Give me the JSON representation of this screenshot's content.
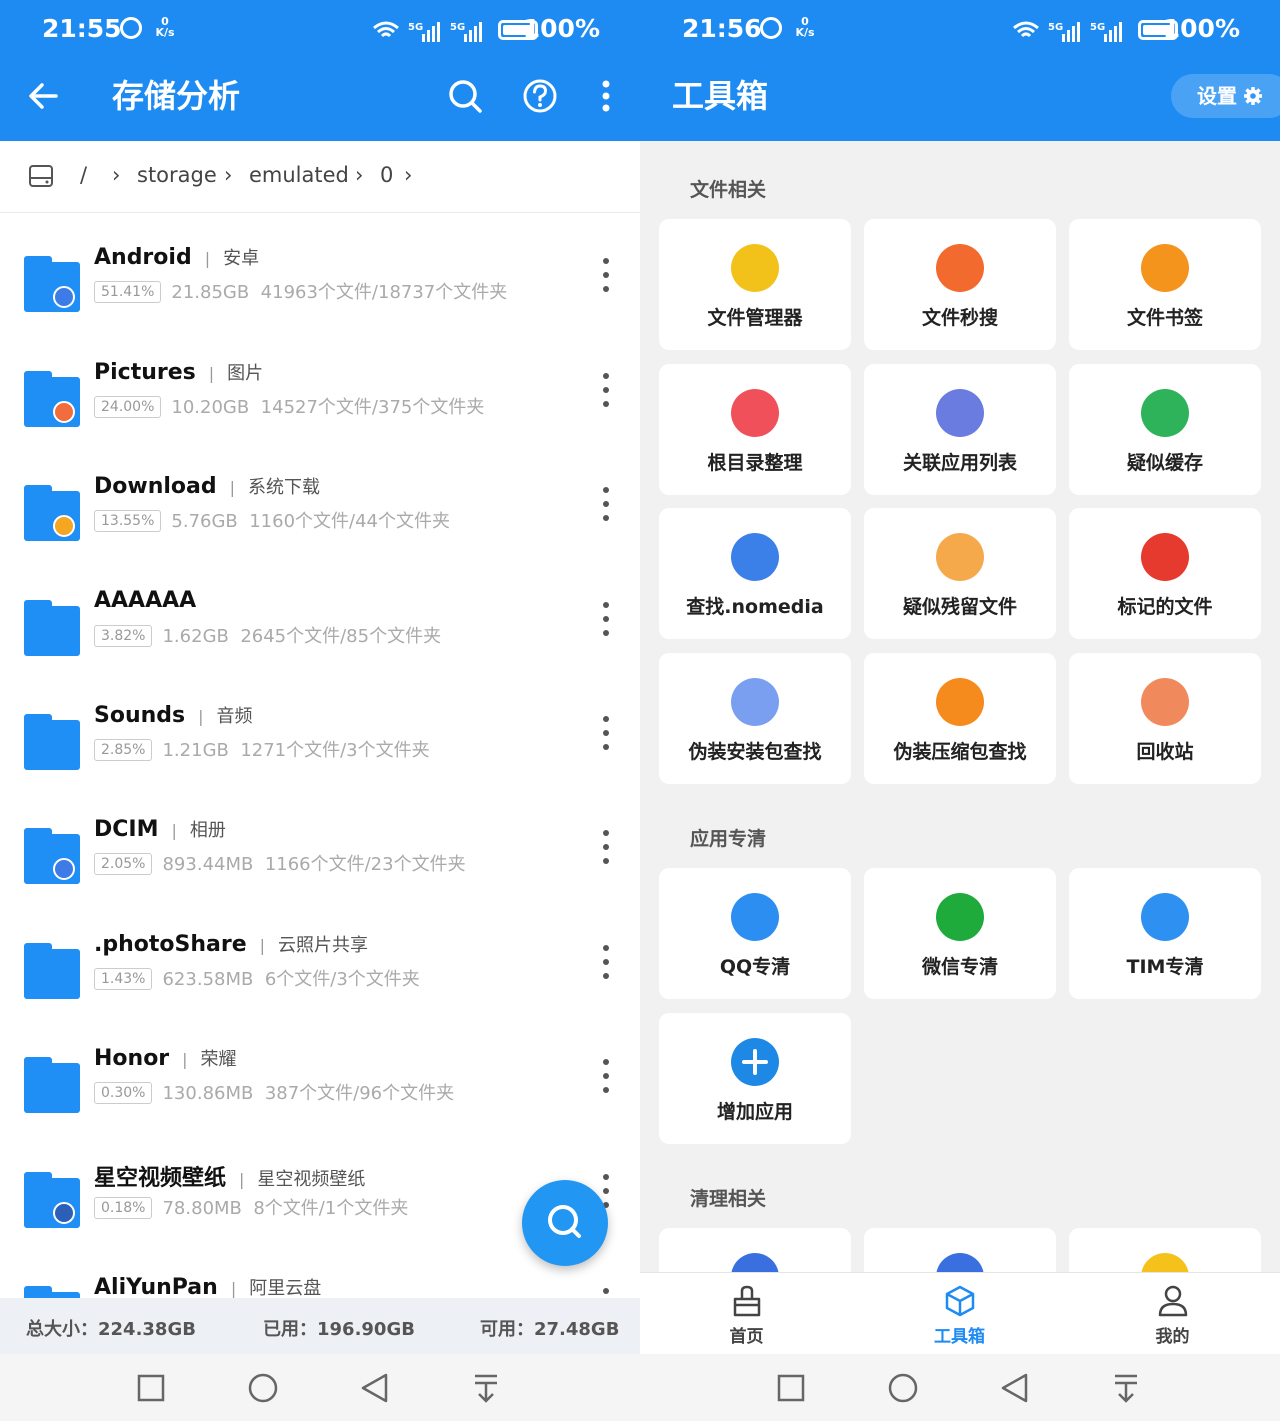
{
  "left": {
    "status": {
      "time": "21:55",
      "speed_value": "0",
      "speed_unit": "K/s",
      "signal": "5G 5G",
      "battery": "100%"
    },
    "title": "存储分析",
    "breadcrumb": [
      "/",
      "storage",
      "emulated",
      "0"
    ],
    "folders": [
      {
        "name": "Android",
        "alias": "安卓",
        "percent": "51.41%",
        "size": "21.85GB",
        "counts": "41963个文件/18737个文件夹",
        "badge_color": "#3d7be6"
      },
      {
        "name": "Pictures",
        "alias": "图片",
        "percent": "24.00%",
        "size": "10.20GB",
        "counts": "14527个文件/375个文件夹",
        "badge_color": "#f26d3d"
      },
      {
        "name": "Download",
        "alias": "系统下载",
        "percent": "13.55%",
        "size": "5.76GB",
        "counts": "1160个文件/44个文件夹",
        "badge_color": "#f5a623"
      },
      {
        "name": "AAAAAA",
        "alias": "",
        "percent": "3.82%",
        "size": "1.62GB",
        "counts": "2645个文件/85个文件夹",
        "badge_color": ""
      },
      {
        "name": "Sounds",
        "alias": "音频",
        "percent": "2.85%",
        "size": "1.21GB",
        "counts": "1271个文件/3个文件夹",
        "badge_color": ""
      },
      {
        "name": "DCIM",
        "alias": "相册",
        "percent": "2.05%",
        "size": "893.44MB",
        "counts": "1166个文件/23个文件夹",
        "badge_color": "#3d7be6"
      },
      {
        "name": ".photoShare",
        "alias": "云照片共享",
        "percent": "1.43%",
        "size": "623.58MB",
        "counts": "6个文件/3个文件夹",
        "badge_color": ""
      },
      {
        "name": "Honor",
        "alias": "荣耀",
        "percent": "0.30%",
        "size": "130.86MB",
        "counts": "387个文件/96个文件夹",
        "badge_color": ""
      },
      {
        "name": "星空视频壁纸",
        "alias": "星空视频壁纸",
        "percent": "0.18%",
        "size": "78.80MB",
        "counts": "8个文件/1个文件夹",
        "badge_color": "#2b5fb8"
      },
      {
        "name": "AliYunPan",
        "alias": "阿里云盘",
        "percent": "",
        "size": "",
        "counts": "",
        "badge_color": ""
      }
    ],
    "footer": {
      "total": "总大小：224.38GB",
      "used": "已用：196.90GB",
      "free": "可用：27.48GB"
    }
  },
  "right": {
    "status": {
      "time": "21:56",
      "speed_value": "0",
      "speed_unit": "K/s",
      "signal": "5G 5G",
      "battery": "100%"
    },
    "title": "工具箱",
    "settings_label": "设置",
    "sections": [
      {
        "label": "文件相关"
      },
      {
        "label": "应用专清"
      },
      {
        "label": "清理相关"
      }
    ],
    "file_tools": [
      {
        "label": "文件管理器",
        "color": "#f2c21b"
      },
      {
        "label": "文件秒搜",
        "color": "#f26a2e"
      },
      {
        "label": "文件书签",
        "color": "#f5941d"
      },
      {
        "label": "根目录整理",
        "color": "#f0505a"
      },
      {
        "label": "关联应用列表",
        "color": "#6b7ce0"
      },
      {
        "label": "疑似缓存",
        "color": "#2fb35a"
      },
      {
        "label": "查找.nomedia",
        "color": "#3a80e8"
      },
      {
        "label": "疑似残留文件",
        "color": "#f5a94a"
      },
      {
        "label": "标记的文件",
        "color": "#e63a2e"
      },
      {
        "label": "伪装安装包查找",
        "color": "#7a9ef0"
      },
      {
        "label": "伪装压缩包查找",
        "color": "#f58a1d"
      },
      {
        "label": "回收站",
        "color": "#f08a5d"
      }
    ],
    "app_tools": [
      {
        "label": "QQ专清",
        "color": "#2b8ef0"
      },
      {
        "label": "微信专清",
        "color": "#1faa3c"
      },
      {
        "label": "TIM专清",
        "color": "#2e90f0"
      },
      {
        "label": "增加应用",
        "color": "#1e88e5"
      }
    ],
    "clean_tools_colors": [
      "#3a6fe0",
      "#3a6fe0",
      "#f5c21b"
    ],
    "tabs": [
      {
        "label": "首页",
        "active": false
      },
      {
        "label": "工具箱",
        "active": true
      },
      {
        "label": "我的",
        "active": false
      }
    ],
    "accent": "#1d8bf2"
  }
}
